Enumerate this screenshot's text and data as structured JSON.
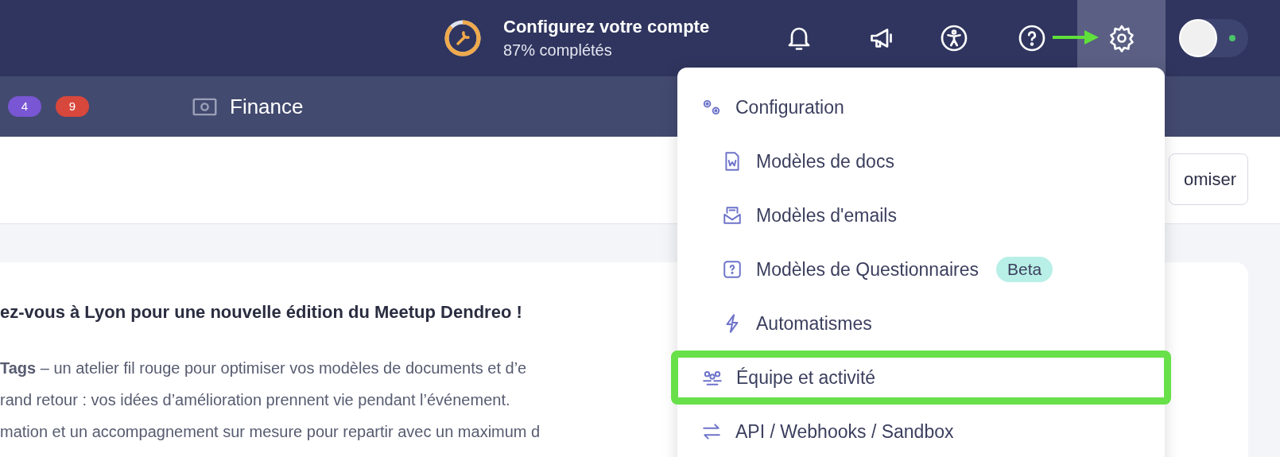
{
  "header": {
    "setup_progress": {
      "level": 0.87,
      "title": "Configurez votre compte",
      "subtitle": "87% complétés"
    },
    "icons": [
      {
        "kind": "bell",
        "selected": false
      },
      {
        "kind": "megaphone",
        "selected": false
      },
      {
        "kind": "accessibility",
        "selected": false
      },
      {
        "kind": "help",
        "selected": false
      },
      {
        "kind": "gear",
        "selected": true
      }
    ],
    "pointer_arrow": true,
    "user": {
      "online": true
    }
  },
  "nav": {
    "badges": [
      {
        "text": "4",
        "color": "#7856d4"
      },
      {
        "text": "9",
        "color": "#d8473b"
      }
    ],
    "items": [
      {
        "kind": "money",
        "label": "Finance"
      }
    ]
  },
  "toolbar": {
    "button": "omiser"
  },
  "content": {
    "heading": "ez-vous à Lyon pour une nouvelle édition du Meetup Dendreo !",
    "lines": [
      "**Tags** – un atelier fil rouge pour optimiser vos modèles de documents et d’e",
      "rand retour : vos idées d’amélioration prennent vie pendant l’événement.",
      "mation et un accompagnement sur mesure pour repartir avec un maximum d"
    ]
  },
  "settings_menu": {
    "items": [
      {
        "kind": "gears",
        "label": "Configuration",
        "highlighted": false,
        "children": [
          {
            "kind": "doc",
            "label": "Modèles de docs",
            "highlighted": false
          },
          {
            "kind": "mail",
            "label": "Modèles d'emails",
            "highlighted": false
          },
          {
            "kind": "question",
            "label": "Modèles de Questionnaires",
            "badge": "Beta",
            "highlighted": false
          },
          {
            "kind": "bolt",
            "label": "Automatismes",
            "highlighted": false
          }
        ]
      },
      {
        "kind": "team",
        "label": "Équipe et activité",
        "highlighted": true
      },
      {
        "kind": "swap",
        "label": "API / Webhooks / Sandbox",
        "highlighted": false
      }
    ]
  }
}
